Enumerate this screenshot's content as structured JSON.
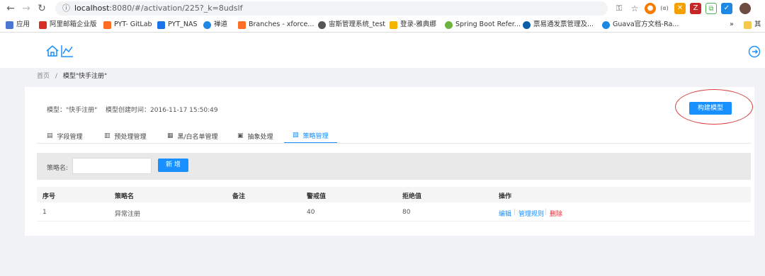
{
  "browser": {
    "url_host": "localhost",
    "url_rest": ":8080/#/activation/225?_k=8udslf",
    "bookmarks": [
      {
        "label": "应用",
        "color": "#4a77d4"
      },
      {
        "label": "阿里邮箱企业版",
        "color": "#d93025"
      },
      {
        "label": "PYT- GitLab",
        "color": "#fc6d26"
      },
      {
        "label": "PYT_NAS",
        "color": "#1a73e8"
      },
      {
        "label": "禅道",
        "color": "#1e88e5"
      },
      {
        "label": "Branches - xforce...",
        "color": "#fc6d26"
      },
      {
        "label": "宙斯管理系统_test",
        "color": "#555555"
      },
      {
        "label": "登录-雅典娜",
        "color": "#f2b600"
      },
      {
        "label": "Spring Boot Refer...",
        "color": "#6db33f"
      },
      {
        "label": "票易通发票管理及...",
        "color": "#0b5fa5"
      },
      {
        "label": "Guava官方文档-Ra...",
        "color": "#1e88e5"
      }
    ],
    "bookmarks_more": "»",
    "bookmarks_other": "其"
  },
  "header": {
    "home_icon": "home-icon",
    "chart_icon": "line-chart-icon",
    "logout_icon": "logout-icon"
  },
  "breadcrumb": {
    "home": "首页",
    "sep": "/",
    "current": "模型\"快手注册\""
  },
  "model": {
    "name_text": "模型：\"快手注册\"",
    "created_text": "模型创建时间：2016-11-17 15:50:49",
    "build_button": "构建模型"
  },
  "tabs": [
    {
      "label": "字段管理",
      "icon": "file-icon"
    },
    {
      "label": "预处理管理",
      "icon": "doc-icon"
    },
    {
      "label": "黑/白名单管理",
      "icon": "grid-icon"
    },
    {
      "label": "抽象处理",
      "icon": "abstract-icon"
    },
    {
      "label": "策略管理",
      "icon": "strategy-icon",
      "active": true
    }
  ],
  "search": {
    "label": "策略名:",
    "value": "",
    "add_button": "新 增"
  },
  "table": {
    "columns": [
      "序号",
      "策略名",
      "备注",
      "警戒值",
      "拒绝值",
      "操作"
    ],
    "rows": [
      {
        "index": "1",
        "name": "异常注册",
        "note": "",
        "warn": "40",
        "reject": "80",
        "actions": [
          "编辑",
          "管理规则",
          "删除"
        ]
      }
    ],
    "action_sep": "|"
  },
  "colors": {
    "accent": "#1890ff",
    "danger": "#f5222d",
    "annotation": "#d94040"
  }
}
